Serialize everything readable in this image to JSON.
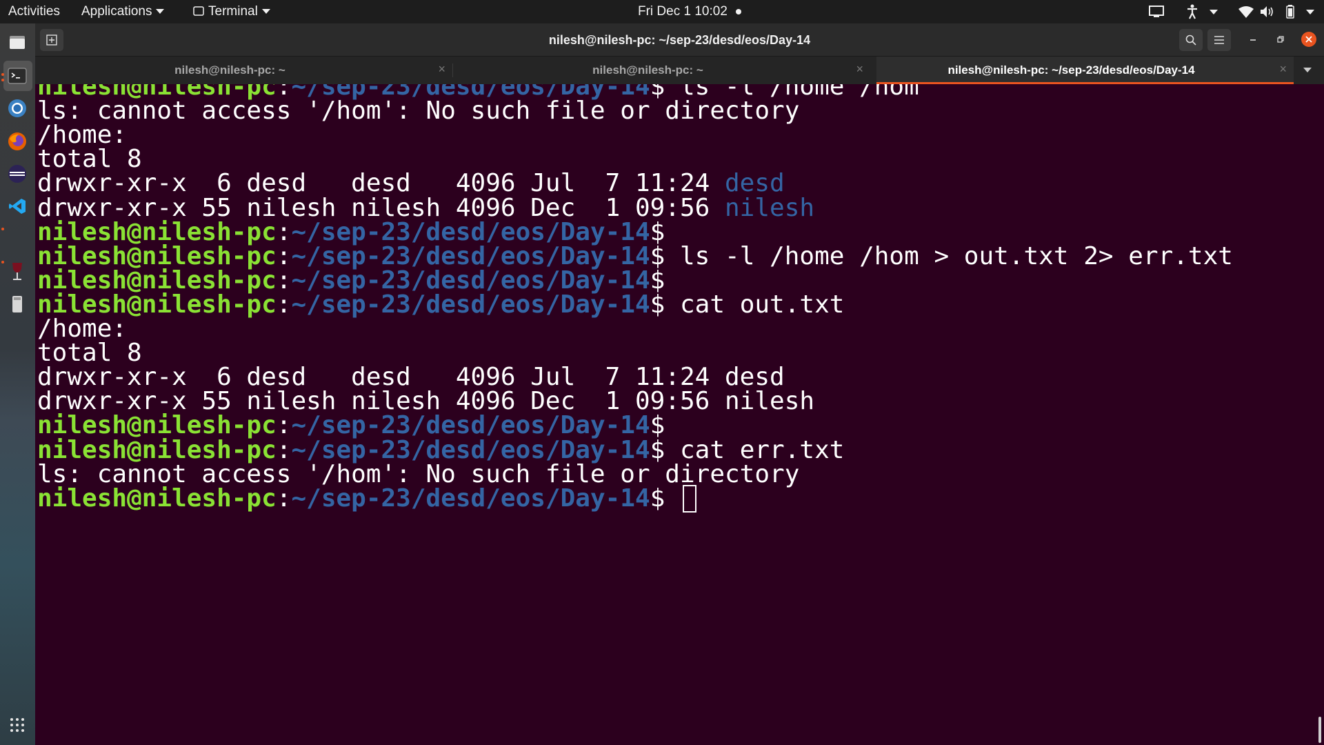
{
  "topbar": {
    "activities": "Activities",
    "applications": "Applications",
    "terminal_menu": "Terminal",
    "clock": "Fri Dec 1  10:02"
  },
  "window": {
    "title": "nilesh@nilesh-pc: ~/sep-23/desd/eos/Day-14"
  },
  "tabs": [
    {
      "label": "nilesh@nilesh-pc: ~",
      "close": "×"
    },
    {
      "label": "nilesh@nilesh-pc: ~",
      "close": "×"
    },
    {
      "label": "nilesh@nilesh-pc: ~/sep-23/desd/eos/Day-14",
      "close": "×"
    }
  ],
  "terminal": {
    "user": "nilesh@nilesh-pc",
    "sep": ":",
    "path": "~/sep-23/desd/eos/Day-14",
    "dollar": "$",
    "lines": [
      {
        "cmd": " ls -l /home /hom"
      },
      {
        "text": "ls: cannot access '/hom': No such file or directory"
      },
      {
        "text": "/home:"
      },
      {
        "text": "total 8"
      },
      {
        "text": "drwxr-xr-x  6 desd   desd   4096 Jul  7 11:24 ",
        "dir": "desd"
      },
      {
        "text": "drwxr-xr-x 55 nilesh nilesh 4096 Dec  1 09:56 ",
        "dir": "nilesh"
      },
      {
        "cmd": ""
      },
      {
        "cmd": " ls -l /home /hom > out.txt 2> err.txt"
      },
      {
        "cmd": ""
      },
      {
        "cmd": " cat out.txt"
      },
      {
        "text": "/home:"
      },
      {
        "text": "total 8"
      },
      {
        "text": "drwxr-xr-x  6 desd   desd   4096 Jul  7 11:24 desd"
      },
      {
        "text": "drwxr-xr-x 55 nilesh nilesh 4096 Dec  1 09:56 nilesh"
      },
      {
        "cmd": ""
      },
      {
        "cmd": " cat err.txt"
      },
      {
        "text": "ls: cannot access '/hom': No such file or directory"
      },
      {
        "cmd": " "
      }
    ]
  },
  "colors": {
    "background": "#2c001e",
    "prompt_user": "#8ae234",
    "prompt_path": "#3465a4",
    "accent": "#e95420"
  },
  "icons": {
    "dock": [
      "files-icon",
      "terminal-icon",
      "chrome-icon",
      "firefox-icon",
      "eclipse-icon",
      "vscode-icon",
      "wine-icon",
      "usb-drive-icon",
      "app-grid-icon"
    ],
    "tray": [
      "screen-icon",
      "accessibility-icon",
      "wifi-icon",
      "volume-icon",
      "battery-icon"
    ]
  }
}
